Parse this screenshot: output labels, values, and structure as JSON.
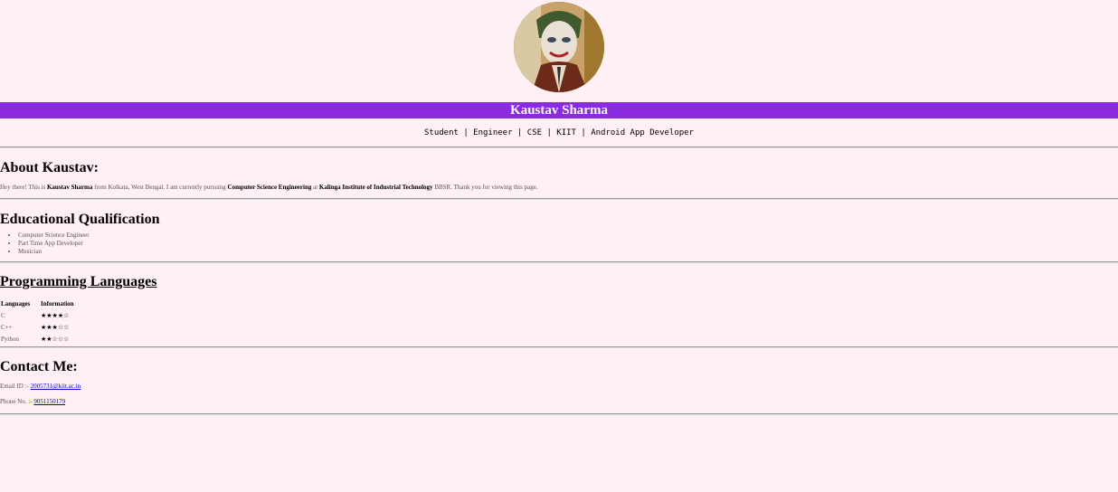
{
  "profile": {
    "name": "Kaustav Sharma",
    "tagline": "Student | Engineer | CSE | KIIT | Android App Developer"
  },
  "about": {
    "title": "About Kaustav:",
    "intro": "Hey there! This is ",
    "name_bold": "Kaustav Sharma",
    "mid1": " from Kolkata, West Bengal. I am currently pursuing ",
    "course_bold": "Computer Science Engineering",
    "mid2": " at ",
    "institute_bold": "Kalinga Institute of Industrial Technology",
    "end": " BBSR. Thank you for viewing this page."
  },
  "education": {
    "title": "Educational Qualification",
    "items": [
      "Computer Science Engineer",
      "Part Time App Developer",
      "Musician"
    ]
  },
  "programming": {
    "title": "Programming Languages",
    "headers": [
      "Languages",
      "Information"
    ],
    "rows": [
      {
        "lang": "C",
        "rating": "★★★★☆"
      },
      {
        "lang": "C++",
        "rating": "★★★☆☆"
      },
      {
        "lang": "Python",
        "rating": "★★☆☆☆"
      }
    ]
  },
  "contact": {
    "title": "Contact Me:",
    "email_label": "Email ID :- ",
    "email": "2005731@kiit.ac.in",
    "phone_label": "Phone No. :- ",
    "phone": "9051150179"
  },
  "icons": {
    "avatar": "profile-photo-joker"
  },
  "colors": {
    "background": "#fff0f5",
    "name_bar": "#8a2be2"
  }
}
